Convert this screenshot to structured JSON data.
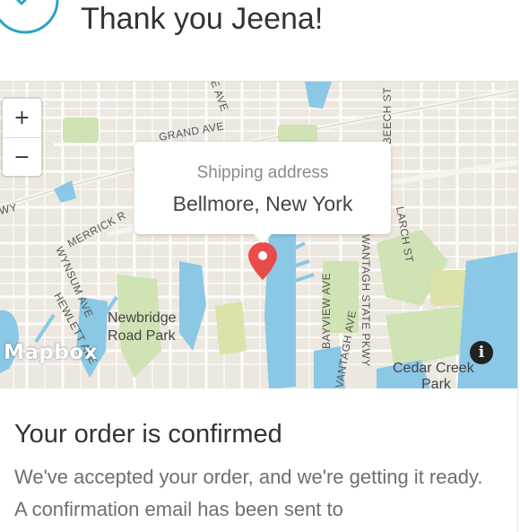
{
  "header": {
    "title": "Thank you Jeena!",
    "check_icon": "check-circle-icon",
    "accent_color": "#2aa2c5"
  },
  "map": {
    "zoom_in_label": "+",
    "zoom_out_label": "−",
    "popup": {
      "label": "Shipping address",
      "value": "Bellmore, New York"
    },
    "attribution_logo": "Mapbox",
    "info_label": "i",
    "pin_color": "#e94b4b",
    "street_labels": {
      "grand_ave": "GRAND AVE",
      "e_ave": "E AVE",
      "beech_st": "BEECH ST",
      "wy": "WY",
      "merrick": "MERRICK R",
      "larch_st": "LARCH ST",
      "wynsum_ave": "WYNSUM AVE",
      "hewlett_ave": "HEWLETT AVE",
      "bayview_ave": "BAYVIEW AVE",
      "vantagh_ave": "VANTAGH AVE",
      "wantagh_state_pkwy": "WANTAGH STATE PKWY",
      "newbridge_1": "Newbridge",
      "newbridge_2": "Road Park",
      "cedar_creek_1": "Cedar Creek",
      "cedar_creek_2": "Park"
    }
  },
  "order": {
    "title": "Your order is confirmed",
    "body": "We've accepted your order, and we're getting it ready. A confirmation email has been sent to"
  }
}
